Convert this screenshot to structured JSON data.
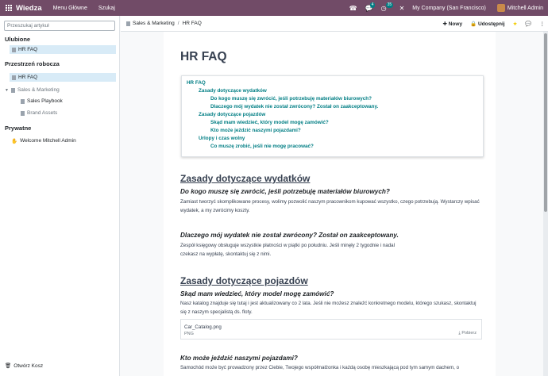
{
  "topbar": {
    "brand": "Wiedza",
    "menu1": "Menu Główne",
    "menu2": "Szukaj",
    "badge1": "4",
    "badge2": "35",
    "company": "My Company (San Francisco)",
    "user": "Mitchell Admin"
  },
  "sidebar": {
    "search_placeholder": "Przeszukaj artykuł",
    "favorites_title": "Ulubione",
    "favorites": [
      "HR FAQ"
    ],
    "workspace_title": "Przestrzeń robocza",
    "workspace": [
      "HR FAQ",
      "Sales & Marketing",
      "Sales Playbook",
      "Brand Assets"
    ],
    "private_title": "Prywatne",
    "private": [
      "Welcome Mitchell Admin"
    ],
    "trash": "Otwórz Kosz"
  },
  "controlpanel": {
    "breadcrumb_parent": "Sales & Marketing",
    "breadcrumb_current": "HR FAQ",
    "new": "Nowy",
    "share": "Udostępnij"
  },
  "article": {
    "title": "HR FAQ",
    "toc": [
      "HR FAQ",
      "Zasady dotyczące wydatków",
      "Do kogo muszę się zwrócić, jeśli potrzebuję materiałów biurowych?",
      "Dlaczego mój wydatek nie został zwrócony? Został on zaakceptowany.",
      "Zasady dotyczące pojazdów",
      "Skąd mam wiedzieć, który model mogę zamówić?",
      "Kto może jeździć naszymi pojazdami?",
      "Urlopy i czas wolny",
      "Co muszę zrobić, jeśli nie mogę pracować?"
    ],
    "s1_title": "Zasady dotyczące wydatków",
    "q1": "Do kogo muszę się zwrócić, jeśli potrzebuję materiałów biurowych?",
    "a1": "Zamiast tworzyć skomplikowane procesy, wolimy pozwolić naszym pracownikom kupować wszystko, czego potrzebują. Wystarczy wpisać wydatek, a my zwrócimy koszty.",
    "q2": "Dlaczego mój wydatek nie został zwrócony? Został on zaakceptowany.",
    "a2": "Zespół księgowy obsługuje wszystkie płatności w piątki po południu. Jeśli minęły 2 tygodnie i nadal czekasz na wypłatę, skontaktuj się z nimi.",
    "s2_title": "Zasady dotyczące pojazdów",
    "q3": "Skąd mam wiedzieć, który model mogę zamówić?",
    "a3": "Nasz katalog znajduje się tutaj i jest aktualizowany co 2 lata. Jeśli nie możesz znaleźć konkretnego modelu, którego szukasz, skontaktuj się z naszym specjalistą ds. floty.",
    "attachment_name": "Car_Catalog.png",
    "attachment_type": "PNG",
    "attachment_download": "Pobierz",
    "q4": "Kto może jeździć naszymi pojazdami?",
    "a4": "Samochód może być prowadzony przez Ciebie, Twojego współmałżonka i każdą osobę mieszkającą pod tym samym dachem, o"
  }
}
